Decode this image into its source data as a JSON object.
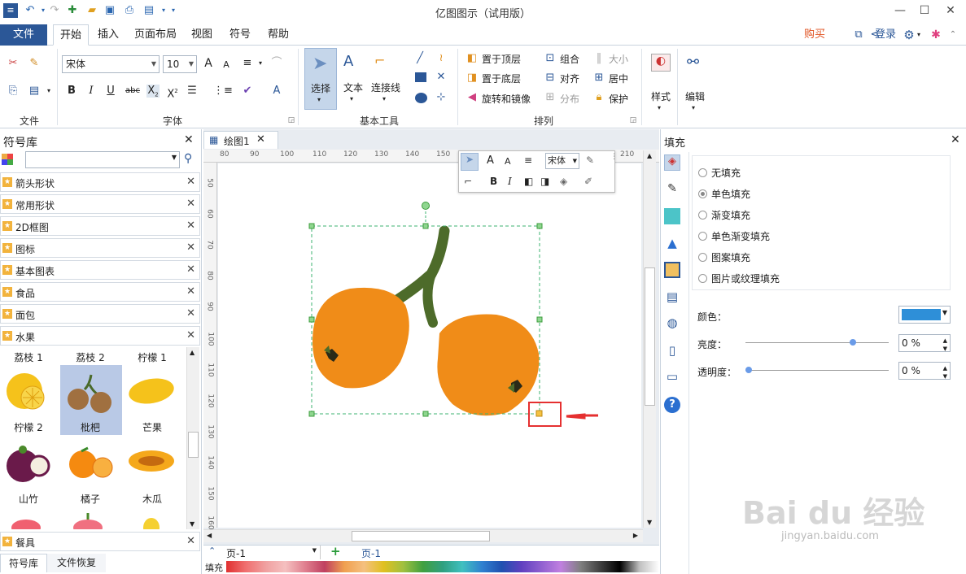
{
  "app": {
    "title": "亿图图示（试用版）"
  },
  "menu": {
    "file": "文件",
    "items": [
      "开始",
      "插入",
      "页面布局",
      "视图",
      "符号",
      "帮助"
    ]
  },
  "account": {
    "buy": "购买",
    "login": "登录"
  },
  "ribbon": {
    "groups": {
      "file": "文件",
      "font": "字体",
      "basic_tools": "基本工具",
      "arrange": "排列"
    },
    "font_name": "宋体",
    "font_size": "10",
    "select": "选择",
    "text": "文本",
    "connector": "连接线",
    "bring_front": "置于顶层",
    "send_back": "置于底层",
    "rotate_mirror": "旋转和镜像",
    "group": "组合",
    "align": "对齐",
    "distribute": "分布",
    "size": "大小",
    "center": "居中",
    "protect": "保护",
    "style": "样式",
    "edit": "编辑"
  },
  "library": {
    "title": "符号库",
    "categories": [
      "箭头形状",
      "常用形状",
      "2D框图",
      "图标",
      "基本图表",
      "食品",
      "面包",
      "水果"
    ],
    "bottom_category": "餐具",
    "thumb_row_labels": [
      "荔枝 1",
      "荔枝 2",
      "柠檬 1"
    ],
    "thumbs": [
      "柠檬 2",
      "枇杷",
      "芒果",
      "山竹",
      "橘子",
      "木瓜"
    ],
    "tabs": [
      "符号库",
      "文件恢复"
    ]
  },
  "document": {
    "tab": "绘图1"
  },
  "ruler": {
    "h": [
      "80",
      "90",
      "100",
      "110",
      "120",
      "130",
      "140",
      "150",
      "210"
    ],
    "v": [
      "50",
      "60",
      "70",
      "80",
      "90",
      "100",
      "110",
      "120",
      "130",
      "140",
      "150",
      "160"
    ]
  },
  "float_toolbar": {
    "font_combo": "宋体"
  },
  "page": {
    "current": "页-1",
    "tab": "页-1"
  },
  "palette": {
    "label": "填充"
  },
  "fill_panel": {
    "title": "填充",
    "options": [
      "无填充",
      "单色填充",
      "渐变填充",
      "单色渐变填充",
      "图案填充",
      "图片或纹理填充"
    ],
    "selected_index": 1,
    "color_label": "颜色：",
    "color_value": "#2e8fd8",
    "brightness_label": "亮度：",
    "brightness_value": "0 %",
    "brightness_level": 0.75,
    "transparency_label": "透明度：",
    "transparency_value": "0 %",
    "transparency_level": 0.0
  },
  "watermark": {
    "brand": "Bai du 经验",
    "url": "jingyan.baidu.com"
  }
}
